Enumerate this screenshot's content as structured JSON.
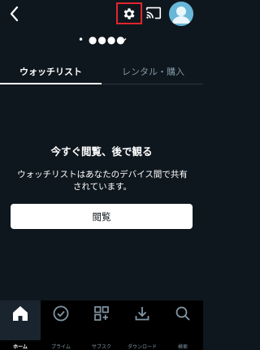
{
  "header": {
    "profile_name": "• ●●●●",
    "back_icon": "chevron-left-icon",
    "settings_icon": "gear-icon",
    "cast_icon": "cast-icon",
    "avatar_icon": "profile-avatar-icon",
    "highlight_color": "#e0262c",
    "avatar_color": "#69b7d8"
  },
  "tabs": [
    {
      "label": "ウォッチリスト",
      "selected": true
    },
    {
      "label": "レンタル・購入",
      "selected": false
    }
  ],
  "empty_state": {
    "title": "今すぐ閲覧、後で観る",
    "description": "ウォッチリストはあなたのデバイス間で共有されています。",
    "button_label": "閲覧"
  },
  "bottom_nav": [
    {
      "label": "ホーム",
      "icon": "home-icon",
      "active": true
    },
    {
      "label": "プライム",
      "icon": "check-circle-icon",
      "active": false
    },
    {
      "label": "サブスク",
      "icon": "grid-plus-icon",
      "active": false
    },
    {
      "label": "ダウンロード",
      "icon": "download-icon",
      "active": false
    },
    {
      "label": "検索",
      "icon": "search-icon",
      "active": false
    }
  ],
  "colors": {
    "background": "#0f171e",
    "inactive_text": "#8197a4",
    "nav_background": "#000000"
  }
}
